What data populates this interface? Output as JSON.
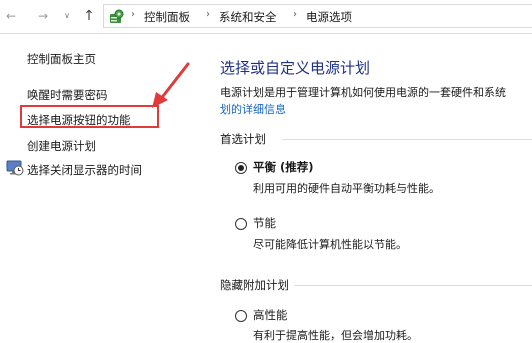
{
  "breadcrumb": {
    "items": [
      "控制面板",
      "系统和安全",
      "电源选项"
    ]
  },
  "sidebar": {
    "home": "控制面板主页",
    "links": [
      "唤醒时需要密码",
      "选择电源按钮的功能",
      "创建电源计划",
      "选择关闭显示器的时间"
    ]
  },
  "main": {
    "title": "选择或自定义电源计划",
    "description": "电源计划是用于管理计算机如何使用电源的一套硬件和系统",
    "link": "划的详细信息",
    "preferred_heading": "首选计划",
    "hidden_heading": "隐藏附加计划",
    "plans": [
      {
        "name": "平衡 (推荐)",
        "description": "利用可用的硬件自动平衡功耗与性能。",
        "selected": true
      },
      {
        "name": "节能",
        "description": "尽可能降低计算机性能以节能。",
        "selected": false
      },
      {
        "name": "高性能",
        "description": "有利于提高性能，但会增加功耗。",
        "selected": false
      }
    ]
  },
  "colors": {
    "title": "#1e3287",
    "link": "#1565c0",
    "highlight": "#e03a3a"
  },
  "icons": [
    "back-arrow-icon",
    "forward-arrow-icon",
    "chevron-down-icon",
    "up-arrow-icon",
    "control-panel-icon",
    "display-clock-icon",
    "red-pointer-arrow"
  ]
}
